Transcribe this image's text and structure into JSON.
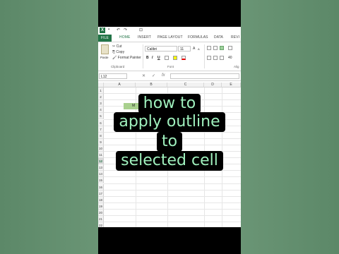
{
  "excel": {
    "logo": "X",
    "quick_access": {
      "undo": "↶",
      "redo": "↷",
      "customize": "⊡"
    },
    "tabs": [
      "FILE",
      "HOME",
      "INSERT",
      "PAGE LAYOUT",
      "FORMULAS",
      "DATA",
      "REVI"
    ],
    "ribbon": {
      "paste_label": "Paste",
      "cut_label": "Cut",
      "copy_label": "Copy",
      "format_painter_label": "Format Painter",
      "clipboard_group": "Clipboard",
      "font_name": "Calibri",
      "font_size": "11",
      "bold": "B",
      "italic": "I",
      "underline": "U",
      "font_group": "Font",
      "alignment_group": "Alig",
      "shrink_label": "A",
      "grow_label": "A",
      "num_label": "40"
    },
    "formula_bar": {
      "name_box": "L12",
      "cancel": "✕",
      "enter": "✓",
      "fx": "fx"
    },
    "columns": [
      "A",
      "B",
      "C",
      "D",
      "E"
    ],
    "rows": [
      "1",
      "2",
      "3",
      "4",
      "5",
      "6",
      "7",
      "8",
      "9",
      "10",
      "11",
      "12",
      "13",
      "14",
      "15",
      "16",
      "17",
      "18",
      "19",
      "20",
      "21",
      "22"
    ],
    "active_row": "12",
    "green_cell_text": "M"
  },
  "caption": {
    "line1": "how to",
    "line2": "apply outline",
    "line3": "to",
    "line4": "selected cell"
  }
}
